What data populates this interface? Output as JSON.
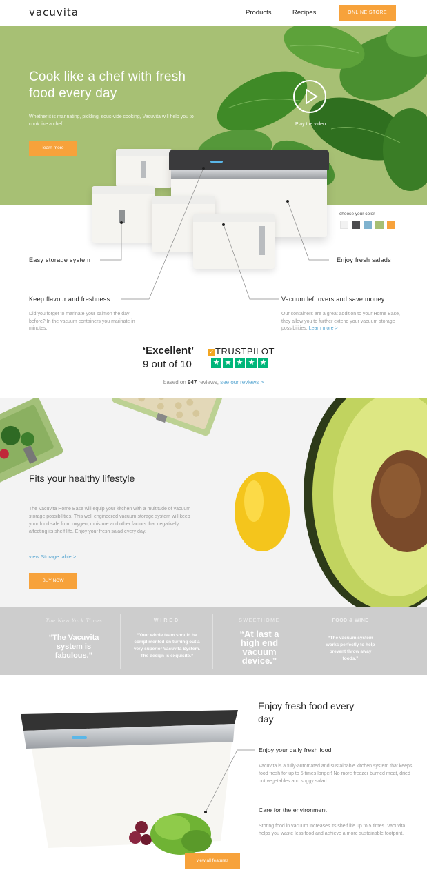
{
  "header": {
    "logo": "vacuvita",
    "nav": [
      "Products",
      "Recipes"
    ],
    "store_button": "ONLINE STORE"
  },
  "hero": {
    "title": "Cook like a chef with fresh food every day",
    "text": "Whether it is marinating, pickling, sous-vide cooking, Vacuvita will help you to cook like a chef.",
    "learn_button": "learn more",
    "video_label": "Play the video"
  },
  "color_picker": {
    "label": "choose your color",
    "colors": [
      "#f2f2f2",
      "#4c4c4e",
      "#7fb3cf",
      "#a6bf73",
      "#f7a23b"
    ]
  },
  "callouts": {
    "storage": "Easy storage system",
    "salads": "Enjoy fresh salads",
    "flavour": "Keep flavour and freshness",
    "flavour_text": "Did you forget to marinate your salmon the day before? In the vacuum containers you marinate in minutes.",
    "vacuum": "Vacuum left overs and save money",
    "vacuum_text": "Our containers are a great addition to your Home Base, they allow you to further extend your vacuum storage possibilities.",
    "vacuum_link": "Learn more >"
  },
  "trustpilot": {
    "rating_word": "‘Excellent’",
    "score": "9 out of 10",
    "brand": "TRUSTPILOT",
    "based_prefix": "based on",
    "review_count": "947",
    "based_suffix": "reviews,",
    "link": "see our reviews >"
  },
  "lifestyle": {
    "title": "Fits your healthy lifestyle",
    "text": "The Vacuvita Home Base will equip your kitchen with a multitude of vacuum storage possibilities. This well engineered vacuum storage system will keep your food safe from oxygen, moisture and other factors that negatively affecting its shelf life. Enjoy your fresh salad every day.",
    "link": "view Storage table >",
    "buy_button": "BUY NOW"
  },
  "press": [
    {
      "source": "The New York Times",
      "quote": "“The Vacuvita system is fabulous.”"
    },
    {
      "source": "WIRED",
      "quote": "“Your whole team should be complimented on turning out a very superior Vacuvita System. The design is exquisite.”"
    },
    {
      "source": "SWEETHOME",
      "quote": "“At last a high end vacuum device.”"
    },
    {
      "source": "FOOD & WINE",
      "quote": "“The vacuum system works perfectly to help prevent throw away foods.”"
    }
  ],
  "bottom": {
    "title": "Enjoy fresh food every day",
    "sub1": "Enjoy your daily fresh food",
    "text1": "Vacuvita is a fully-automated and sustainable kitchen system that keeps food fresh for up to 5 times longer! No more freezer burned meat, dried out vegetables and soggy salad.",
    "sub2": "Care for the environment",
    "text2": "Storing food in vacuum increases its shelf life up to 5 times. Vacuvita helps you waste less food and achieve a more sustainable footprint.",
    "features_button": "view all features"
  }
}
